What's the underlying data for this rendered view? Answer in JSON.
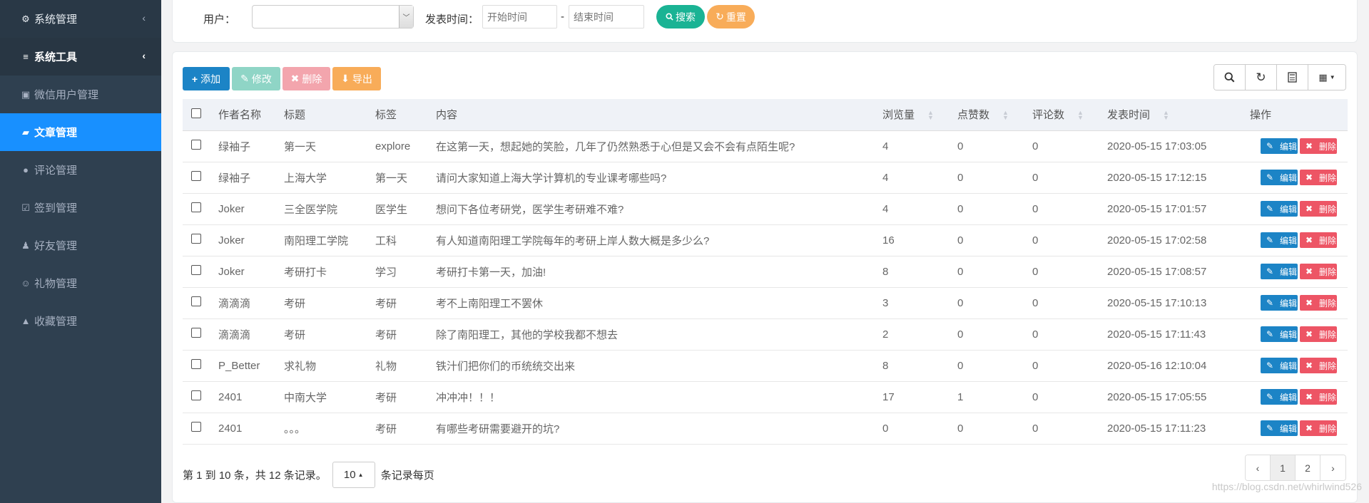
{
  "sidebar": {
    "items": [
      {
        "label": "系统管理",
        "icon": "gear-icon",
        "glyph": "⚙",
        "type": "group"
      },
      {
        "label": "系统工具",
        "icon": "bars-icon",
        "glyph": "≡",
        "type": "group-open"
      },
      {
        "label": "微信用户管理",
        "icon": "id-card-icon",
        "glyph": "▣",
        "type": "item"
      },
      {
        "label": "文章管理",
        "icon": "book-icon",
        "glyph": "▰",
        "type": "active"
      },
      {
        "label": "评论管理",
        "icon": "comment-icon",
        "glyph": "●",
        "type": "item"
      },
      {
        "label": "签到管理",
        "icon": "check-square-icon",
        "glyph": "☑",
        "type": "item"
      },
      {
        "label": "好友管理",
        "icon": "user-plus-icon",
        "glyph": "♟",
        "type": "item"
      },
      {
        "label": "礼物管理",
        "icon": "smile-icon",
        "glyph": "☺",
        "type": "item"
      },
      {
        "label": "收藏管理",
        "icon": "thumbs-up-icon",
        "glyph": "▲",
        "type": "item"
      }
    ]
  },
  "search": {
    "user_label": "用户：",
    "time_label": "发表时间：",
    "start_placeholder": "开始时间",
    "end_placeholder": "结束时间",
    "dash": "-",
    "search_button": "搜索",
    "reset_button": "重置"
  },
  "toolbar": {
    "add": "添加",
    "edit": "修改",
    "delete": "删除",
    "export": "导出"
  },
  "table": {
    "headers": [
      "作者名称",
      "标题",
      "标签",
      "内容",
      "浏览量",
      "点赞数",
      "评论数",
      "发表时间",
      "操作"
    ],
    "edit_label": "编辑",
    "delete_label": "删除",
    "rows": [
      [
        "绿袖子",
        "第一天",
        "explore",
        "在这第一天，想起她的笑脸，几年了仍然熟悉于心但是又会不会有点陌生呢?",
        "4",
        "0",
        "0",
        "2020-05-15 17:03:05"
      ],
      [
        "绿袖子",
        "上海大学",
        "第一天",
        "请问大家知道上海大学计算机的专业课考哪些吗?",
        "4",
        "0",
        "0",
        "2020-05-15 17:12:15"
      ],
      [
        "Joker",
        "三全医学院",
        "医学生",
        "想问下各位考研党，医学生考研难不难?",
        "4",
        "0",
        "0",
        "2020-05-15 17:01:57"
      ],
      [
        "Joker",
        "南阳理工学院",
        "工科",
        "有人知道南阳理工学院每年的考研上岸人数大概是多少么?",
        "16",
        "0",
        "0",
        "2020-05-15 17:02:58"
      ],
      [
        "Joker",
        "考研打卡",
        "学习",
        "考研打卡第一天，加油!",
        "8",
        "0",
        "0",
        "2020-05-15 17:08:57"
      ],
      [
        "滴滴滴",
        "考研",
        "考研",
        "考不上南阳理工不罢休",
        "3",
        "0",
        "0",
        "2020-05-15 17:10:13"
      ],
      [
        "滴滴滴",
        "考研",
        "考研",
        "除了南阳理工，其他的学校我都不想去",
        "2",
        "0",
        "0",
        "2020-05-15 17:11:43"
      ],
      [
        "P_Better",
        "求礼物",
        "礼物",
        "铁汁们把你们的币统统交出来",
        "8",
        "0",
        "0",
        "2020-05-16 12:10:04"
      ],
      [
        "2401",
        "中南大学",
        "考研",
        "冲冲冲！！！",
        "17",
        "1",
        "0",
        "2020-05-15 17:05:55"
      ],
      [
        "2401",
        "。。。",
        "考研",
        "有哪些考研需要避开的坑?",
        "0",
        "0",
        "0",
        "2020-05-15 17:11:23"
      ]
    ]
  },
  "pagination": {
    "summary": "第 1 到 10 条，共 12 条记录。",
    "page_size": "10",
    "per_page_label": "条记录每页",
    "prev": "‹",
    "pages": [
      "1",
      "2"
    ],
    "next": "›"
  },
  "watermark": "https://blog.csdn.net/whirlwind526",
  "colors": {
    "sidebar_bg": "#2f4050",
    "active": "#1890ff",
    "primary": "#1c84c6",
    "danger": "#ed5565",
    "success": "#1ab394",
    "warning": "#f8ac59"
  }
}
